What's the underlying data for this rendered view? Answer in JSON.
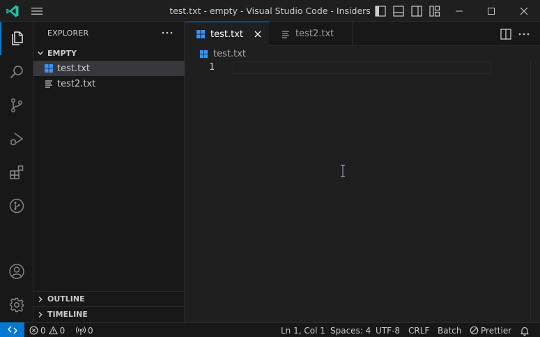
{
  "window": {
    "title": "test.txt - empty - Visual Studio Code - Insiders"
  },
  "sidebar": {
    "header": "EXPLORER",
    "folder": "EMPTY",
    "files": [
      {
        "name": "test.txt",
        "icon": "windows-file-icon",
        "selected": true
      },
      {
        "name": "test2.txt",
        "icon": "text-lines-icon",
        "selected": false
      }
    ],
    "outline_label": "OUTLINE",
    "timeline_label": "TIMELINE"
  },
  "tabs": [
    {
      "label": "test.txt",
      "active": true
    },
    {
      "label": "test2.txt",
      "active": false
    }
  ],
  "breadcrumb": {
    "file": "test.txt"
  },
  "editor": {
    "line_numbers": [
      "1"
    ]
  },
  "statusbar": {
    "errors": "0",
    "warnings": "0",
    "ports": "0",
    "position": "Ln 1, Col 1",
    "spaces": "Spaces: 4",
    "encoding": "UTF-8",
    "eol": "CRLF",
    "language": "Batch",
    "prettier": "Prettier"
  },
  "colors": {
    "accent": "#0078d4",
    "logo": "#24bfa5",
    "windows_file": "#3794ff"
  }
}
